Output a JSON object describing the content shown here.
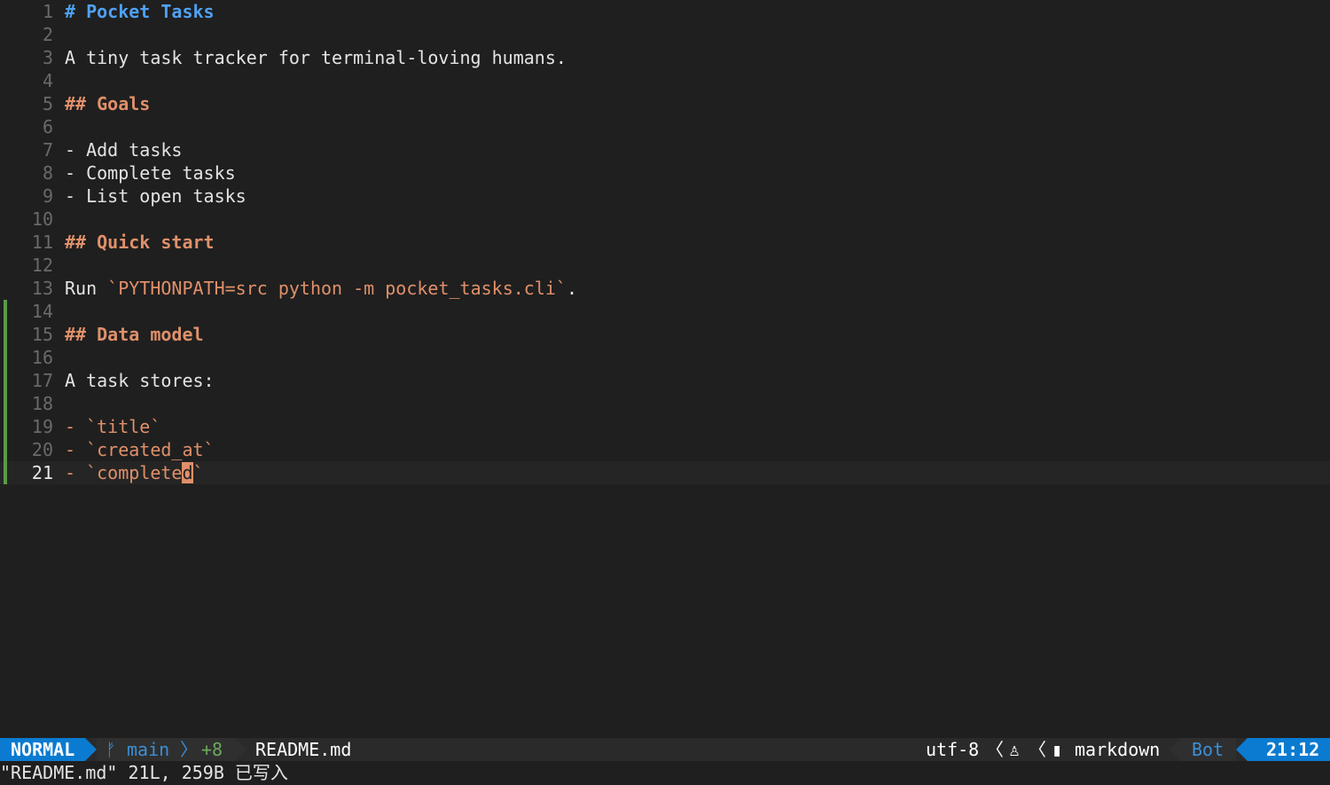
{
  "editor": {
    "lines": [
      {
        "num": "1",
        "kind": "h1",
        "text": "# Pocket Tasks",
        "changed": false
      },
      {
        "num": "2",
        "kind": "blank",
        "text": "",
        "changed": false
      },
      {
        "num": "3",
        "kind": "normal",
        "text": "A tiny task tracker for terminal-loving humans.",
        "changed": false
      },
      {
        "num": "4",
        "kind": "blank",
        "text": "",
        "changed": false
      },
      {
        "num": "5",
        "kind": "h2",
        "text": "## Goals",
        "changed": false
      },
      {
        "num": "6",
        "kind": "blank",
        "text": "",
        "changed": false
      },
      {
        "num": "7",
        "kind": "normal",
        "text": "- Add tasks",
        "changed": false
      },
      {
        "num": "8",
        "kind": "normal",
        "text": "- Complete tasks",
        "changed": false
      },
      {
        "num": "9",
        "kind": "normal",
        "text": "- List open tasks",
        "changed": false
      },
      {
        "num": "10",
        "kind": "blank",
        "text": "",
        "changed": false
      },
      {
        "num": "11",
        "kind": "h2",
        "text": "## Quick start",
        "changed": false
      },
      {
        "num": "12",
        "kind": "blank",
        "text": "",
        "changed": false
      },
      {
        "num": "13",
        "kind": "run",
        "prefix": "Run ",
        "code": "`PYTHONPATH=src python -m pocket_tasks.cli`",
        "suffix": ".",
        "changed": false
      },
      {
        "num": "14",
        "kind": "blank",
        "text": "",
        "changed": true
      },
      {
        "num": "15",
        "kind": "h2",
        "text": "## Data model",
        "changed": true
      },
      {
        "num": "16",
        "kind": "blank",
        "text": "",
        "changed": true
      },
      {
        "num": "17",
        "kind": "normal",
        "text": "A task stores:",
        "changed": true
      },
      {
        "num": "18",
        "kind": "blank",
        "text": "",
        "changed": true
      },
      {
        "num": "19",
        "kind": "codeitem",
        "dash": "- ",
        "code": "`title`",
        "changed": true
      },
      {
        "num": "20",
        "kind": "codeitem",
        "dash": "- ",
        "code": "`created_at`",
        "changed": true
      },
      {
        "num": "21",
        "kind": "cursoritem",
        "dash": "- ",
        "before": "`complete",
        "cursor": "d",
        "after": "`",
        "changed": true
      }
    ]
  },
  "statusline": {
    "mode": "NORMAL",
    "branch_icon": "ᚠ",
    "branch": "main",
    "sep_right": "〉",
    "diff": "+8",
    "filename": "README.md",
    "encoding": "utf-8",
    "sep_left": "〈",
    "os_icon": "♙",
    "filetype_icon": "▮",
    "filetype": "markdown",
    "percent": "Bot",
    "location": "21:12"
  },
  "cmdline": {
    "message": "\"README.md\" 21L, 259B 已写入"
  },
  "colors": {
    "background": "#1f1f1f",
    "mode_bg": "#0a7bd0",
    "heading1": "#4ea1f3",
    "heading2": "#e0906a",
    "git_added": "#5a9a4a"
  }
}
